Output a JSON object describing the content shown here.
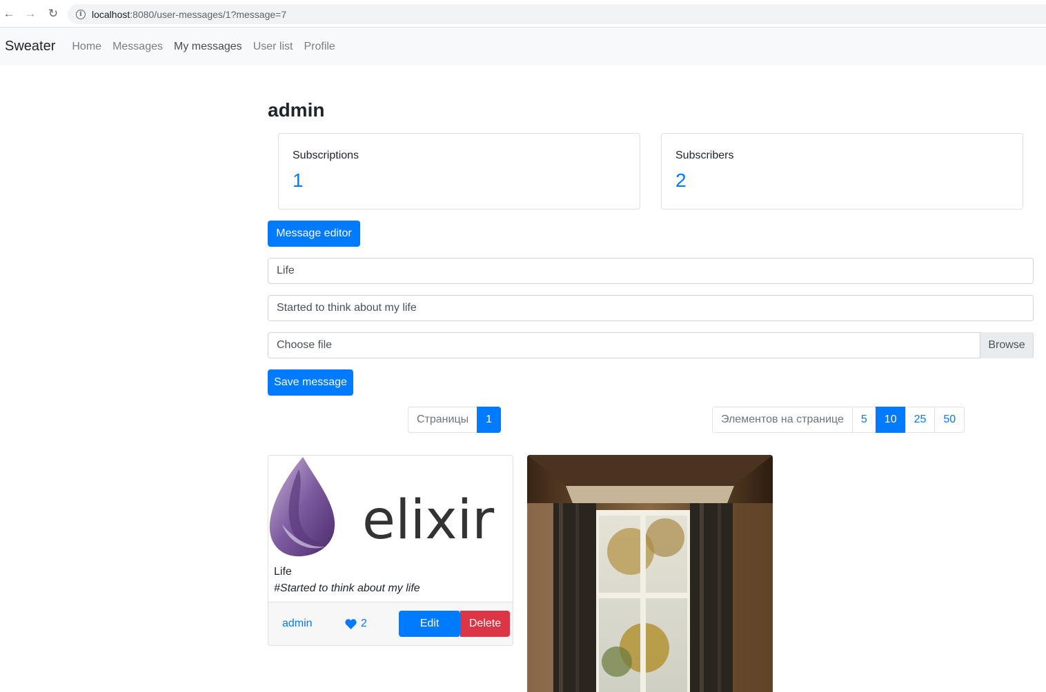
{
  "browser": {
    "url_host": "localhost",
    "url_path": ":8080/user-messages/1?message=7"
  },
  "navbar": {
    "brand": "Sweater",
    "links": [
      "Home",
      "Messages",
      "My messages",
      "User list",
      "Profile"
    ],
    "active_link": "My messages"
  },
  "profile": {
    "username": "admin",
    "subscriptions_label": "Subscriptions",
    "subscriptions_count": "1",
    "subscribers_label": "Subscribers",
    "subscribers_count": "2"
  },
  "editor": {
    "toggle_label": "Message editor",
    "title_value": "Life",
    "text_value": "Started to think about my life",
    "file_placeholder": "Choose file",
    "browse_label": "Browse",
    "save_label": "Save message"
  },
  "pagination": {
    "pages_label": "Страницы",
    "pages": [
      "1"
    ],
    "current_page": "1",
    "size_label": "Элементов на странице",
    "sizes": [
      "5",
      "10",
      "25",
      "50"
    ],
    "current_size": "10"
  },
  "messages": [
    {
      "image_text": "elixir",
      "title": "Life",
      "tag": "#Started to think about my life",
      "author": "admin",
      "likes": "2",
      "edit_label": "Edit",
      "delete_label": "Delete"
    }
  ],
  "colors": {
    "primary": "#007bff",
    "danger": "#dc3545",
    "navbar_bg": "#f8f9fa"
  }
}
